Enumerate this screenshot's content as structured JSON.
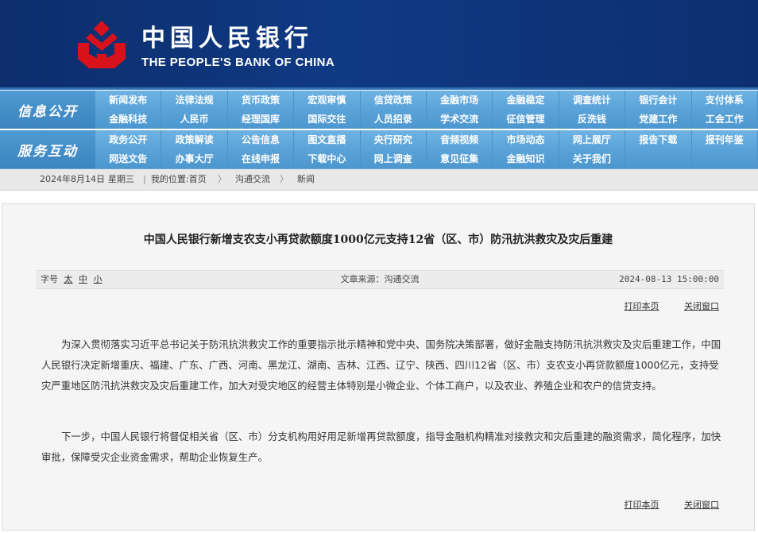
{
  "header": {
    "name_cn": "中国人民银行",
    "name_en": "THE PEOPLE'S BANK OF CHINA",
    "logo_color": "#d7121b"
  },
  "nav": {
    "group1_label": "信息公开",
    "group2_label": "服务互动",
    "group1_row1": [
      "新闻发布",
      "法律法规",
      "货币政策",
      "宏观审慎",
      "信贷政策",
      "金融市场",
      "金融稳定",
      "调查统计",
      "银行会计",
      "支付体系"
    ],
    "group1_row2": [
      "金融科技",
      "人民币",
      "经理国库",
      "国际交往",
      "人员招录",
      "学术交流",
      "征信管理",
      "反洗钱",
      "党建工作",
      "工会工作"
    ],
    "group2_row1": [
      "政务公开",
      "政策解读",
      "公告信息",
      "图文直播",
      "央行研究",
      "音频视频",
      "市场动态",
      "网上展厅",
      "报告下载",
      "报刊年鉴"
    ],
    "group2_row2": [
      "网送文告",
      "办事大厅",
      "在线申报",
      "下载中心",
      "网上调查",
      "意见征集",
      "金融知识",
      "关于我们",
      "",
      ""
    ]
  },
  "breadcrumb": {
    "date": "2024年8月14日",
    "weekday": "星期三",
    "sep": "|",
    "location": "我的位置:首页",
    "arrow1": "〉",
    "level1": "沟通交流",
    "arrow2": "〉",
    "level2": "新闻"
  },
  "article": {
    "title": "中国人民银行新增支农支小再贷款额度1000亿元支持12省（区、市）防汛抗洪救灾及灾后重建",
    "font_label": "字号",
    "font_large": "太",
    "font_medium": "中",
    "font_small": "小",
    "source": "文章来源：沟通交流",
    "datetime": "2024-08-13 15:00:00",
    "print": "打印本页",
    "close": "关闭窗口",
    "paragraph1": "为深入贯彻落实习近平总书记关于防汛抗洪救灾工作的重要指示批示精神和党中央、国务院决策部署，做好金融支持防汛抗洪救灾及灾后重建工作，中国人民银行决定新增重庆、福建、广东、广西、河南、黑龙江、湖南、吉林、江西、辽宁、陕西、四川12省（区、市）支农支小再贷款额度1000亿元，支持受灾严重地区防汛抗洪救灾及灾后重建工作，加大对受灾地区的经营主体特别是小微企业、个体工商户，以及农业、养殖企业和农户的信贷支持。",
    "paragraph2": "下一步，中国人民银行将督促相关省（区、市）分支机构用好用足新增再贷款额度，指导金融机构精准对接救灾和灾后重建的融资需求，简化程序，加快审批，保障受灾企业资金需求，帮助企业恢复生产。"
  }
}
